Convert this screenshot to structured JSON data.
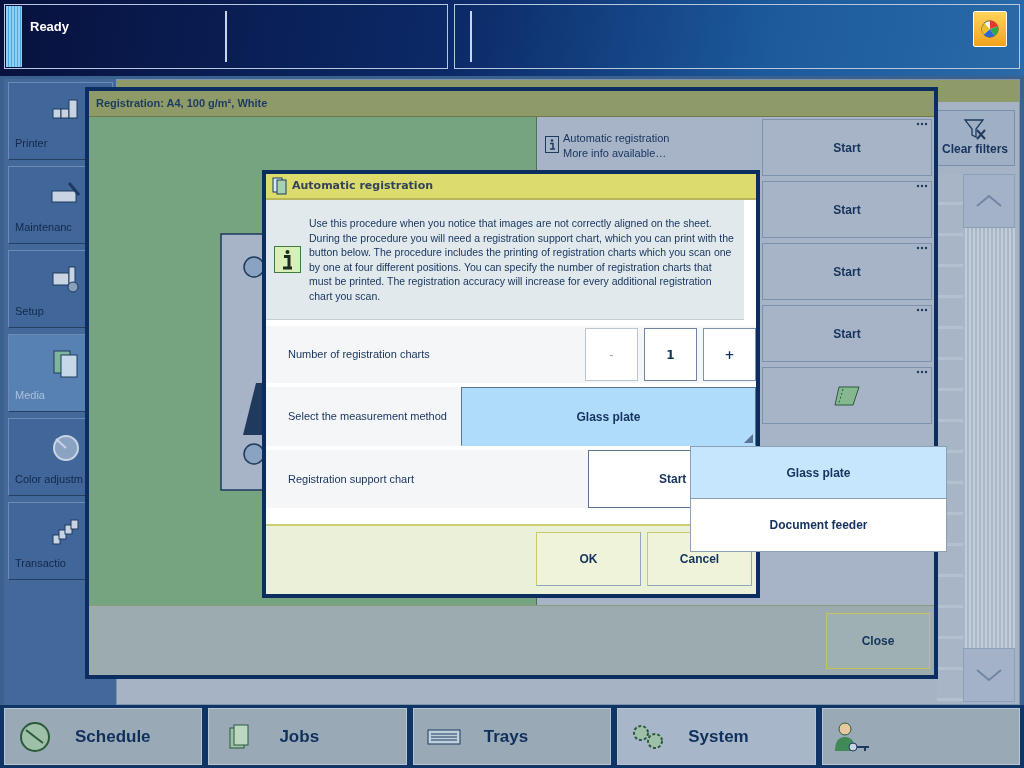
{
  "status_bar": {
    "status": "Ready"
  },
  "sidebar": {
    "items": [
      {
        "label": "Printer",
        "selected": false
      },
      {
        "label": "Maintenanc",
        "selected": false
      },
      {
        "label": "Setup",
        "selected": false
      },
      {
        "label": "Media",
        "selected": true
      },
      {
        "label": "Color adjustm",
        "selected": false
      },
      {
        "label": "Transactio",
        "selected": false
      }
    ]
  },
  "background_panel": {
    "clear_filters": "Clear filters"
  },
  "registration_dialog": {
    "title": "Registration: A4, 100 g/m², White",
    "info": {
      "title": "Automatic registration",
      "subtitle": "More info available…"
    },
    "actions": [
      {
        "kind": "text",
        "label": "Start"
      },
      {
        "kind": "text",
        "label": "Start"
      },
      {
        "kind": "text",
        "label": "Start"
      },
      {
        "kind": "text",
        "label": "Start"
      },
      {
        "kind": "icon"
      }
    ],
    "close": "Close"
  },
  "auto_registration_dialog": {
    "title": "Automatic registration",
    "description": "Use this procedure when you notice that images are not correctly aligned on the sheet. During the procedure you will need a registration support chart, which you can print with the button below. The procedure includes the printing of registration charts which you scan one by one at four different positions. You can specify the number of registration charts that must be printed. The registration accuracy will increase for every additional registration chart you scan.",
    "counter": {
      "label": "Number of registration charts",
      "value": "1",
      "decrement": {
        "label": "-",
        "disabled": true
      },
      "increment": {
        "label": "+",
        "disabled": false
      }
    },
    "method": {
      "label": "Select the measurement method",
      "value": "Glass plate",
      "expanded": true
    },
    "support_chart": {
      "label": "Registration support chart",
      "button": "Start"
    },
    "buttons": [
      "OK",
      "Cancel"
    ]
  },
  "dropdown": {
    "options": [
      {
        "label": "Glass plate",
        "selected": true
      },
      {
        "label": "Document feeder",
        "selected": false
      }
    ]
  },
  "bottom_tabs": [
    {
      "label": "Schedule",
      "selected": false
    },
    {
      "label": "Jobs",
      "selected": false
    },
    {
      "label": "Trays",
      "selected": false
    },
    {
      "label": "System",
      "selected": true
    }
  ]
}
